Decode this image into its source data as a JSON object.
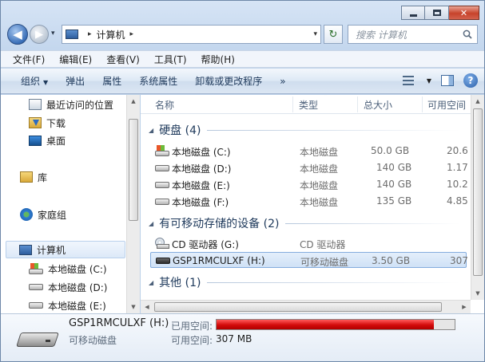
{
  "window": {
    "caption": {
      "minimize": "",
      "maximize": "",
      "close": "✕"
    }
  },
  "nav": {
    "back_glyph": "◀",
    "forward_glyph": "▶",
    "dropdown_glyph": "▾",
    "address": {
      "sep": "▸",
      "location": "计算机",
      "trail_sep": "▸"
    },
    "refresh_glyph": "↻",
    "search_placeholder": "搜索 计算机"
  },
  "menubar": {
    "items": [
      "文件(F)",
      "编辑(E)",
      "查看(V)",
      "工具(T)",
      "帮助(H)"
    ]
  },
  "toolbar": {
    "organize": "组织",
    "eject": "弹出",
    "properties": "属性",
    "system_properties": "系统属性",
    "uninstall": "卸载或更改程序",
    "more": "»"
  },
  "navpane": {
    "items": [
      {
        "label": "最近访问的位置",
        "icon": "recent-places-icon"
      },
      {
        "label": "下载",
        "icon": "downloads-folder-icon"
      },
      {
        "label": "桌面",
        "icon": "desktop-icon"
      },
      {
        "label": "库",
        "icon": "libraries-icon"
      },
      {
        "label": "家庭组",
        "icon": "homegroup-icon"
      },
      {
        "label": "计算机",
        "icon": "computer-icon"
      },
      {
        "label": "本地磁盘 (C:)",
        "icon": "system-drive-icon"
      },
      {
        "label": "本地磁盘 (D:)",
        "icon": "hard-drive-icon"
      },
      {
        "label": "本地磁盘 (E:)",
        "icon": "hard-drive-icon"
      }
    ]
  },
  "columns": {
    "name": "名称",
    "type": "类型",
    "total": "总大小",
    "free": "可用空间"
  },
  "groups": {
    "hdd": "硬盘 (4)",
    "removable": "有可移动存储的设备 (2)",
    "other": "其他 (1)"
  },
  "drives": [
    {
      "name": "本地磁盘 (C:)",
      "type": "本地磁盘",
      "total": "50.0 GB",
      "free": "20.6"
    },
    {
      "name": "本地磁盘 (D:)",
      "type": "本地磁盘",
      "total": "140 GB",
      "free": "1.17"
    },
    {
      "name": "本地磁盘 (E:)",
      "type": "本地磁盘",
      "total": "140 GB",
      "free": "10.2"
    },
    {
      "name": "本地磁盘 (F:)",
      "type": "本地磁盘",
      "total": "135 GB",
      "free": "4.85"
    }
  ],
  "removable": [
    {
      "name": "CD 驱动器 (G:)",
      "type": "CD 驱动器"
    },
    {
      "name": "GSP1RMCULXF (H:)",
      "type": "可移动磁盘",
      "total": "3.50 GB",
      "free": "307"
    }
  ],
  "details": {
    "name": "GSP1RMCULXF (H:)",
    "type": "可移动磁盘",
    "used_label": "已用空间:",
    "free_label": "可用空间:",
    "free_value": "307 MB",
    "used_fraction": 0.914,
    "bar_color": "#d30b0b"
  }
}
